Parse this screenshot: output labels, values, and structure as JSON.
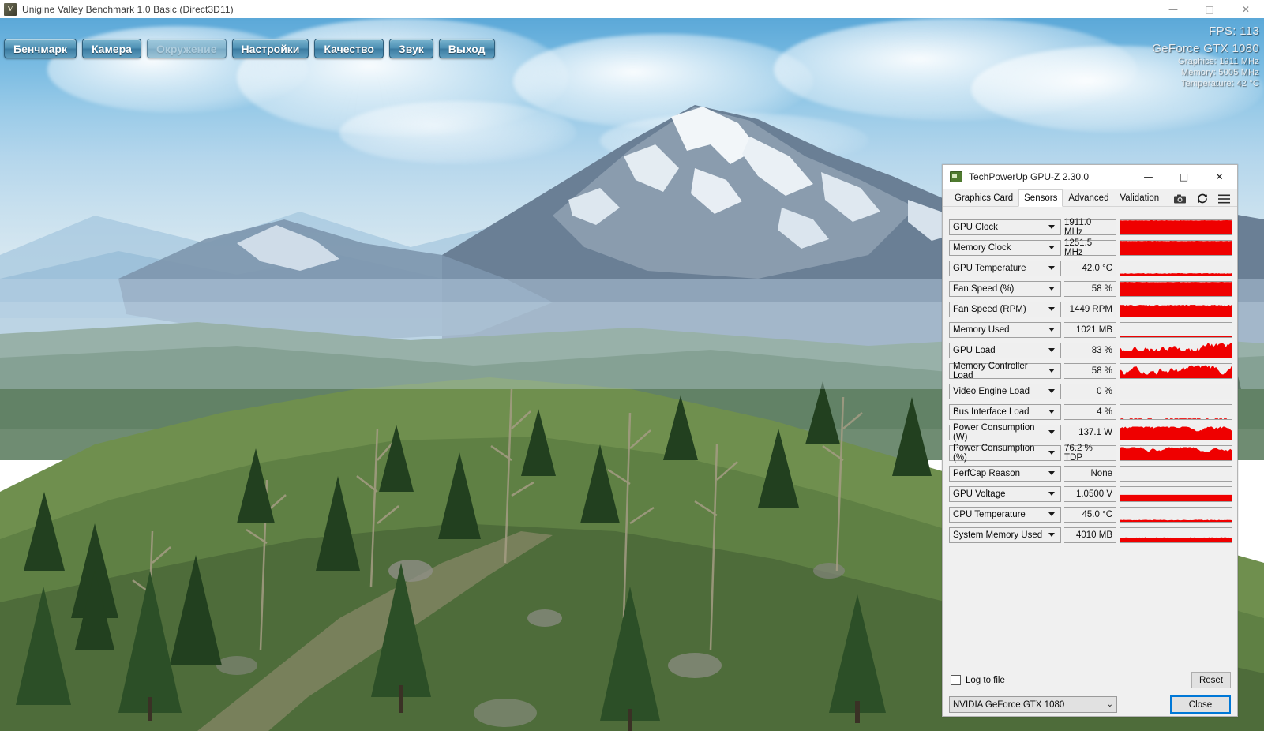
{
  "app": {
    "title": "Unigine Valley Benchmark 1.0 Basic (Direct3D11)",
    "icon": "valley-logo-icon",
    "window_buttons": {
      "minimize": "—",
      "maximize": "□",
      "close": "✕"
    }
  },
  "menu": {
    "items": [
      {
        "label": "Бенчмарк",
        "disabled": false
      },
      {
        "label": "Камера",
        "disabled": false
      },
      {
        "label": "Окружение",
        "disabled": true
      },
      {
        "label": "Настройки",
        "disabled": false
      },
      {
        "label": "Качество",
        "disabled": false
      },
      {
        "label": "Звук",
        "disabled": false
      },
      {
        "label": "Выход",
        "disabled": false
      }
    ]
  },
  "hud": {
    "fps": "FPS: 113",
    "gpu_name": "GeForce GTX 1080",
    "graphics_clock": "Graphics: 1911 MHz",
    "memory_clock": "Memory: 5005 MHz",
    "temperature": "Temperature: 42 °C"
  },
  "gpuz": {
    "title": "TechPowerUp GPU-Z 2.30.0",
    "icon": "gpu-card-icon",
    "window_buttons": {
      "minimize": "—",
      "maximize": "□",
      "close": "✕"
    },
    "tabs": [
      {
        "label": "Graphics Card",
        "active": false
      },
      {
        "label": "Sensors",
        "active": true
      },
      {
        "label": "Advanced",
        "active": false
      },
      {
        "label": "Validation",
        "active": false
      }
    ],
    "tools": [
      {
        "icon": "camera-icon",
        "glyph": "📷"
      },
      {
        "icon": "refresh-icon",
        "glyph": "↻"
      },
      {
        "icon": "hamburger-menu-icon",
        "glyph": "☰"
      }
    ],
    "sensors": [
      {
        "name": "GPU Clock",
        "value": "1911.0 MHz",
        "graph": "full",
        "level": 0.97
      },
      {
        "name": "Memory Clock",
        "value": "1251.5 MHz",
        "graph": "full",
        "level": 0.97
      },
      {
        "name": "GPU Temperature",
        "value": "42.0 °C",
        "graph": "lowline",
        "level": 0.14
      },
      {
        "name": "Fan Speed (%)",
        "value": "58 %",
        "graph": "full",
        "level": 0.93
      },
      {
        "name": "Fan Speed (RPM)",
        "value": "1449 RPM",
        "graph": "high",
        "level": 0.8
      },
      {
        "name": "Memory Used",
        "value": "1021 MB",
        "graph": "thinline",
        "level": 0.06
      },
      {
        "name": "GPU Load",
        "value": "83 %",
        "graph": "noisy",
        "level": 0.85
      },
      {
        "name": "Memory Controller Load",
        "value": "58 %",
        "graph": "noisy",
        "level": 0.62
      },
      {
        "name": "Video Engine Load",
        "value": "0 %",
        "graph": "empty",
        "level": 0.0
      },
      {
        "name": "Bus Interface Load",
        "value": "4 %",
        "graph": "dashline",
        "level": 0.05
      },
      {
        "name": "Power Consumption (W)",
        "value": "137.1 W",
        "graph": "noisy",
        "level": 0.78
      },
      {
        "name": "Power Consumption (%)",
        "value": "76.2 % TDP",
        "graph": "noisy",
        "level": 0.78
      },
      {
        "name": "PerfCap Reason",
        "value": "None",
        "graph": "empty",
        "level": 0.0
      },
      {
        "name": "GPU Voltage",
        "value": "1.0500 V",
        "graph": "band",
        "level": 0.45
      },
      {
        "name": "CPU Temperature",
        "value": "45.0 °C",
        "graph": "dotline",
        "level": 0.12
      },
      {
        "name": "System Memory Used",
        "value": "4010 MB",
        "graph": "band2",
        "level": 0.3
      }
    ],
    "log_to_file": {
      "label": "Log to file",
      "checked": false
    },
    "reset_label": "Reset",
    "gpu_selector": {
      "value": "NVIDIA GeForce GTX 1080",
      "chevron": "⌄"
    },
    "close_label": "Close",
    "graph_color": "#ef0000",
    "graph_bg": "#efefef"
  }
}
